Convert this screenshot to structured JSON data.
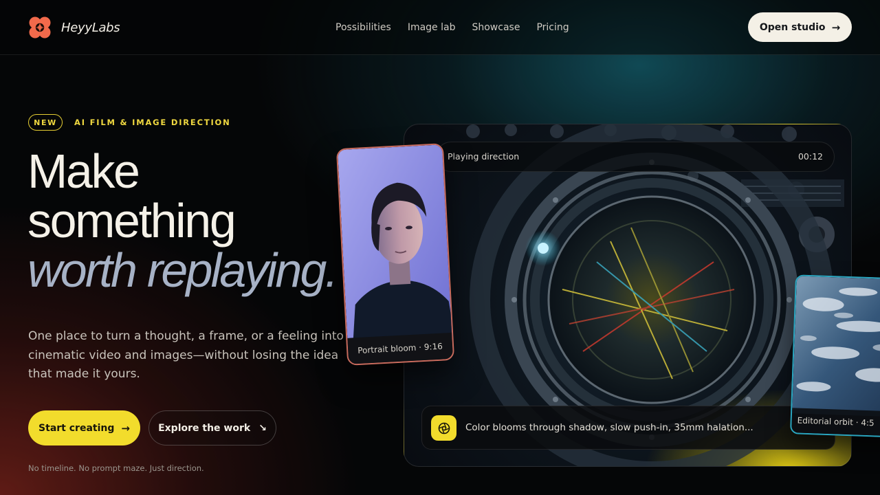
{
  "brand": {
    "name": "HeyyLabs",
    "logo_icon": "flower-aperture-icon",
    "accent": "#f26a4b"
  },
  "nav": {
    "links": [
      "Possibilities",
      "Image lab",
      "Showcase",
      "Pricing"
    ],
    "cta_label": "Open studio",
    "cta_icon": "arrow-right-icon"
  },
  "hero": {
    "badge": "NEW",
    "eyebrow": "AI FILM & IMAGE DIRECTION",
    "headline": {
      "line1": "Make",
      "line2": "something",
      "line3": "worth replaying."
    },
    "lede": "One place to turn a thought, a frame, or a feeling into cinematic video and images—without losing the idea that made it yours.",
    "primary_cta": "Start creating",
    "secondary_cta": "Explore the work",
    "footnote": "No timeline. No prompt maze. Just direction."
  },
  "stage": {
    "status_label": "Playing direction",
    "timecode": "00:12",
    "prompt": "Color blooms through shadow, slow push-in, 35mm halation...",
    "prompt_icon": "aperture-icon"
  },
  "cards": {
    "portrait": {
      "caption": "Portrait bloom · 9:16"
    },
    "earth": {
      "caption": "Editorial orbit · 4:5"
    }
  },
  "colors": {
    "accent_yellow": "#f2dc2c",
    "headline_italic": "#a7b2c6",
    "background": "#050607"
  }
}
